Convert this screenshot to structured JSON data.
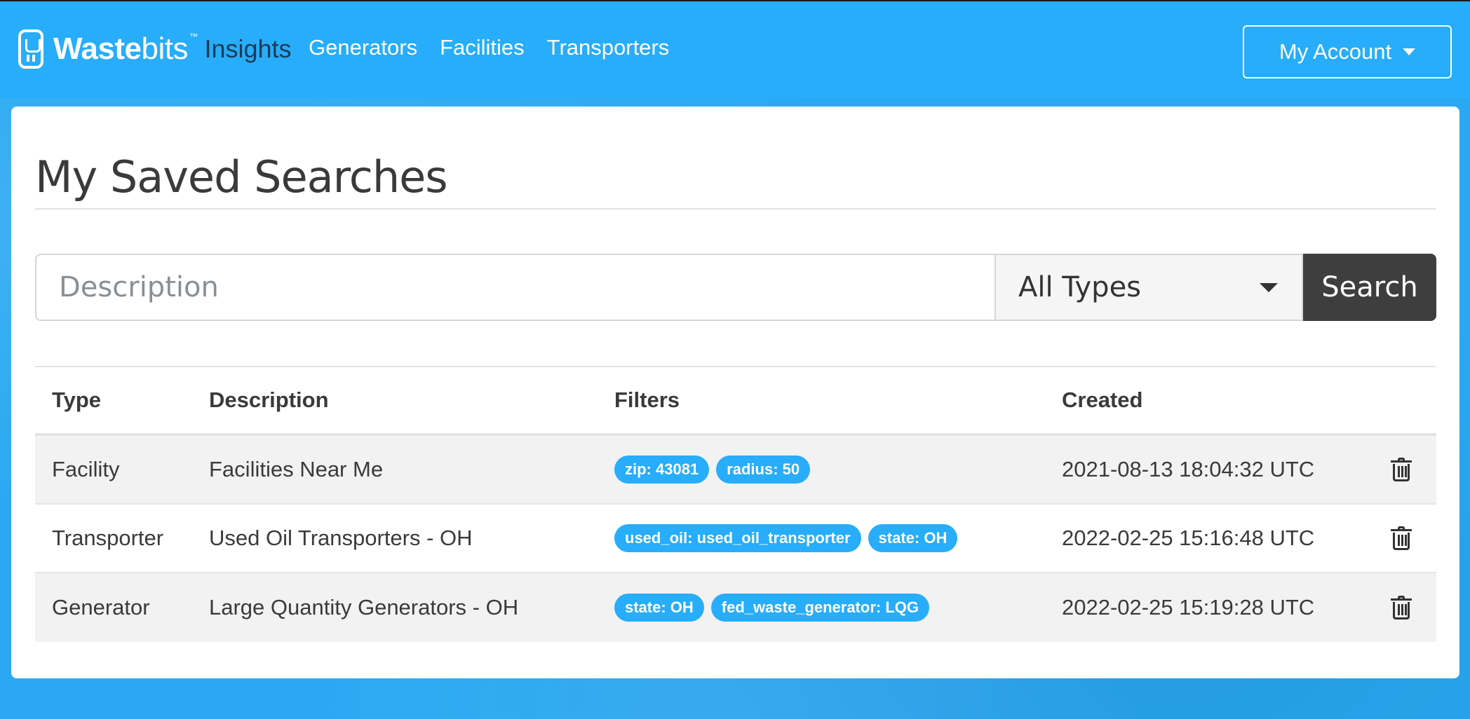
{
  "brand": {
    "name_bold": "Waste",
    "name_light": "bits",
    "tm": "™",
    "product": "Insights"
  },
  "nav": {
    "links": [
      {
        "label": "Generators"
      },
      {
        "label": "Facilities"
      },
      {
        "label": "Transporters"
      }
    ],
    "account_label": "My Account"
  },
  "page": {
    "title": "My Saved Searches"
  },
  "search": {
    "placeholder": "Description",
    "value": "",
    "type_selected": "All Types",
    "button_label": "Search"
  },
  "table": {
    "headers": {
      "type": "Type",
      "description": "Description",
      "filters": "Filters",
      "created": "Created"
    },
    "rows": [
      {
        "type": "Facility",
        "description": "Facilities Near Me",
        "filters": [
          "zip: 43081",
          "radius: 50"
        ],
        "created": "2021-08-13 18:04:32 UTC"
      },
      {
        "type": "Transporter",
        "description": "Used Oil Transporters - OH",
        "filters": [
          "used_oil: used_oil_transporter",
          "state: OH"
        ],
        "created": "2022-02-25 15:16:48 UTC"
      },
      {
        "type": "Generator",
        "description": "Large Quantity Generators - OH",
        "filters": [
          "state: OH",
          "fed_waste_generator: LQG"
        ],
        "created": "2022-02-25 15:19:28 UTC"
      }
    ]
  },
  "colors": {
    "brand_blue": "#27adfa",
    "badge_blue": "#27adfa",
    "search_button": "#3e3e3e"
  },
  "icons": {
    "logo": "wastebits-logo",
    "delete": "trash-icon",
    "account_caret": "chevron-down-icon",
    "select_caret": "chevron-down-icon"
  }
}
